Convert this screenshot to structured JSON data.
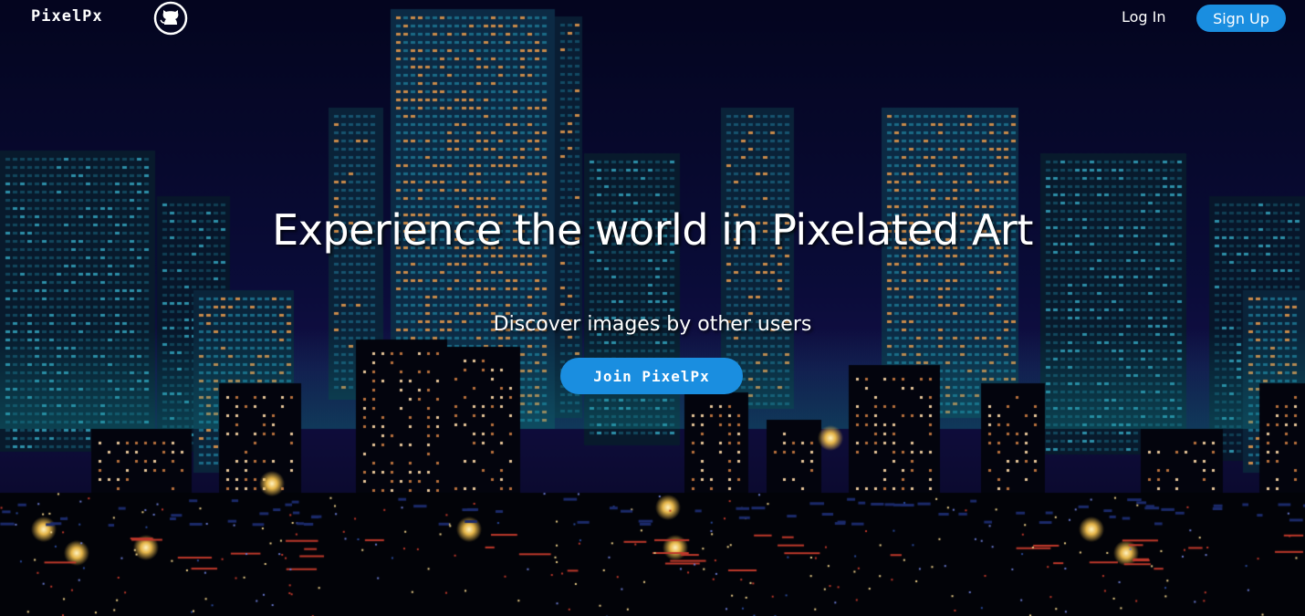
{
  "nav": {
    "logo": "PixelPx",
    "github_icon": "github-icon",
    "login_label": "Log In",
    "signup_label": "Sign Up"
  },
  "hero": {
    "title": "Experience the world in Pixelated Art",
    "subtitle": "Discover images by other users",
    "cta_label": "Join PixelPx"
  },
  "colors": {
    "accent": "#1a8ee0",
    "sky": "#060826",
    "window_lit": "#c98a4a",
    "building_teal": "#0e4a60"
  }
}
